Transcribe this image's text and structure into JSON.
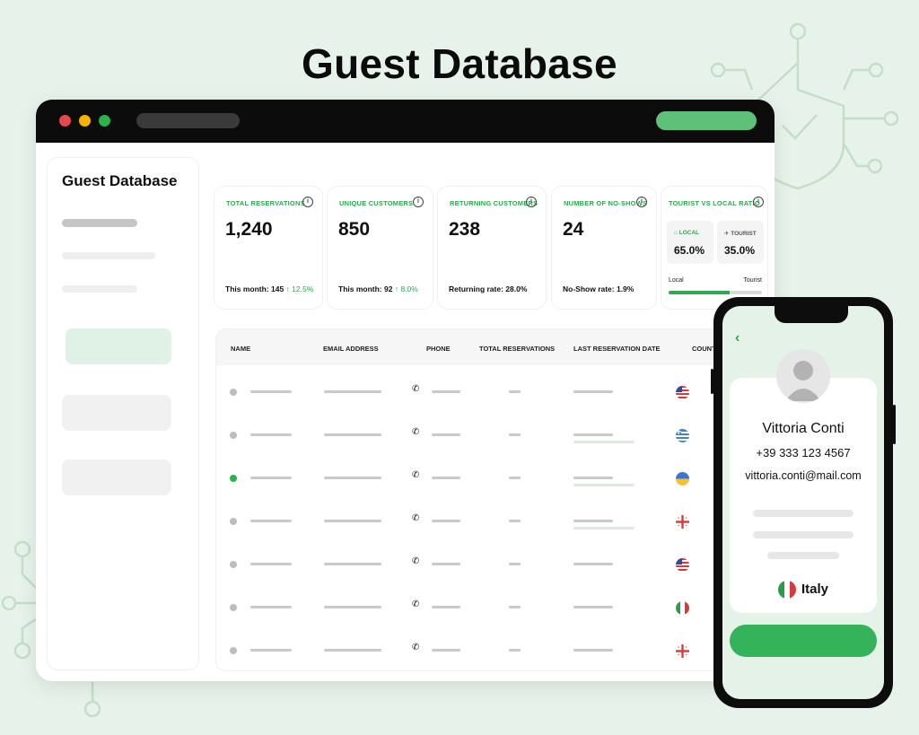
{
  "hero": {
    "title": "Guest Database"
  },
  "browser": {
    "sidebar": {
      "title": "Guest Database"
    },
    "stats": [
      {
        "label": "TOTAL RESERVATIONS",
        "value": "1,240",
        "foot": "This month: 145",
        "delta": "↑ 12.5%"
      },
      {
        "label": "UNIQUE CUSTOMERS",
        "value": "850",
        "foot": "This month: 92",
        "delta": "↑ 8.0%"
      },
      {
        "label": "RETURNING CUSTOMERS",
        "value": "238",
        "foot": "Returning rate: 28.0%",
        "delta": ""
      },
      {
        "label": "NUMBER OF NO-SHOWS",
        "value": "24",
        "foot": "No-Show rate: 1.9%",
        "delta": ""
      }
    ],
    "ratio": {
      "label": "TOURIST VS LOCAL RATIO",
      "local_label": "LOCAL",
      "local_value": "65.0%",
      "tourist_label": "TOURIST",
      "tourist_value": "35.0%",
      "bar_local_text": "Local",
      "bar_tourist_text": "Tourist",
      "local_fraction": 0.65
    },
    "table": {
      "columns": [
        "NAME",
        "EMAIL ADDRESS",
        "PHONE",
        "TOTAL RESERVATIONS",
        "LAST RESERVATION DATE",
        "COUNTRY"
      ],
      "rows": [
        {
          "status": "inactive",
          "flag": "us"
        },
        {
          "status": "inactive",
          "flag": "gr"
        },
        {
          "status": "active",
          "flag": "ua"
        },
        {
          "status": "inactive",
          "flag": "ge"
        },
        {
          "status": "inactive",
          "flag": "us"
        },
        {
          "status": "inactive",
          "flag": "it"
        },
        {
          "status": "inactive",
          "flag": "ge"
        }
      ]
    }
  },
  "phone": {
    "name": "Vittoria Conti",
    "phone": "+39 333 123 4567",
    "email": "vittoria.conti@mail.com",
    "country": "Italy"
  },
  "colors": {
    "accent": "#2fa84f",
    "background": "#e7f3ea",
    "button": "#34b35a"
  },
  "icons": [
    "shield-check-icon",
    "info-icon",
    "phone-icon",
    "back-chevron-icon",
    "avatar-icon",
    "home-icon",
    "plane-icon"
  ]
}
